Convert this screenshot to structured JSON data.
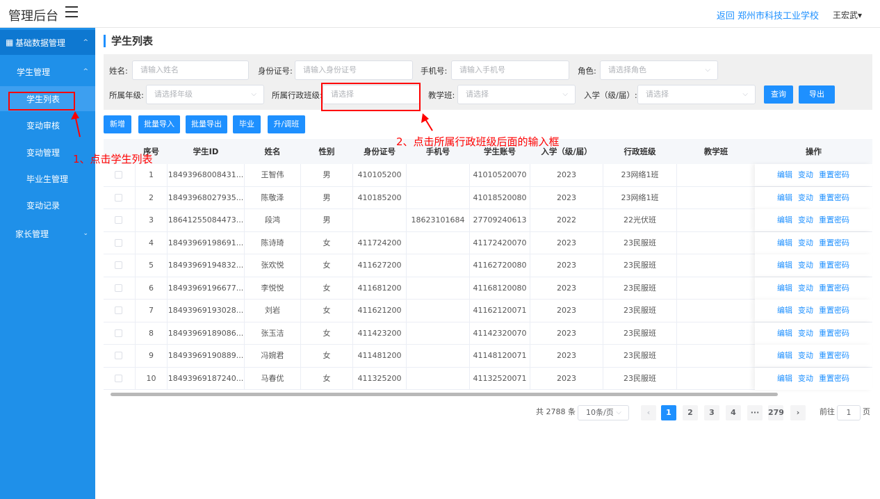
{
  "header": {
    "brand": "管理后台",
    "return_link": "返回 郑州市科技工业学校",
    "user": "王宏武▾"
  },
  "sidebar": {
    "items": [
      {
        "label": "基础数据管理",
        "arrow": "^"
      },
      {
        "label": "学生管理",
        "arrow": "^"
      },
      {
        "label": "学生列表"
      },
      {
        "label": "变动审核"
      },
      {
        "label": "变动管理"
      },
      {
        "label": "毕业生管理"
      },
      {
        "label": "变动记录"
      },
      {
        "label": "家长管理",
        "arrow": "⌄"
      }
    ]
  },
  "page": {
    "title": "学生列表"
  },
  "filters": {
    "name_label": "姓名:",
    "name_placeholder": "请输入姓名",
    "id_label": "身份证号:",
    "id_placeholder": "请输入身份证号",
    "phone_label": "手机号:",
    "phone_placeholder": "请输入手机号",
    "role_label": "角色:",
    "role_placeholder": "请选择角色",
    "grade_label": "所属年级:",
    "grade_placeholder": "请选择年级",
    "class_label": "所属行政班级:",
    "class_placeholder": "请选择",
    "teach_label": "教学班:",
    "teach_placeholder": "请选择",
    "year_label": "入学（级/届）:",
    "year_placeholder": "请选择",
    "query": "查询",
    "export": "导出"
  },
  "toolbar": {
    "add": "新增",
    "bulk_import": "批量导入",
    "bulk_export": "批量导出",
    "graduate": "毕业",
    "upgrade": "升/调班"
  },
  "table": {
    "headers": {
      "idx": "序号",
      "sid": "学生ID",
      "name": "姓名",
      "gender": "性别",
      "idcard": "身份证号",
      "phone": "手机号",
      "account": "学生账号",
      "year": "入学（级/届）",
      "admin_class": "行政班级",
      "teach_class": "教学班",
      "ops": "操作"
    },
    "op_labels": {
      "edit": "编辑",
      "change": "变动",
      "reset": "重置密码"
    },
    "rows": [
      {
        "idx": "1",
        "sid": "18493968008431...",
        "name": "王智伟",
        "gender": "男",
        "idcard": "410105200",
        "phone": "",
        "account": "41010520070",
        "year": "2023",
        "admin_class": "23网络1班",
        "teach_class": ""
      },
      {
        "idx": "2",
        "sid": "18493968027935...",
        "name": "陈敬泽",
        "gender": "男",
        "idcard": "410185200",
        "phone": "",
        "account": "41018520080",
        "year": "2023",
        "admin_class": "23网络1班",
        "teach_class": ""
      },
      {
        "idx": "3",
        "sid": "18641255084473...",
        "name": "段鸿",
        "gender": "男",
        "idcard": "",
        "phone": "18623101684",
        "account": "27709240613",
        "year": "2022",
        "admin_class": "22光伏班",
        "teach_class": ""
      },
      {
        "idx": "4",
        "sid": "18493969198691...",
        "name": "陈诗琦",
        "gender": "女",
        "idcard": "411724200",
        "phone": "",
        "account": "41172420070",
        "year": "2023",
        "admin_class": "23民服班",
        "teach_class": ""
      },
      {
        "idx": "5",
        "sid": "18493969194832...",
        "name": "张欢悦",
        "gender": "女",
        "idcard": "411627200",
        "phone": "",
        "account": "41162720080",
        "year": "2023",
        "admin_class": "23民服班",
        "teach_class": ""
      },
      {
        "idx": "6",
        "sid": "18493969196677...",
        "name": "李悦悦",
        "gender": "女",
        "idcard": "411681200",
        "phone": "",
        "account": "41168120080",
        "year": "2023",
        "admin_class": "23民服班",
        "teach_class": ""
      },
      {
        "idx": "7",
        "sid": "18493969193028...",
        "name": "刘岩",
        "gender": "女",
        "idcard": "411621200",
        "phone": "",
        "account": "41162120071",
        "year": "2023",
        "admin_class": "23民服班",
        "teach_class": ""
      },
      {
        "idx": "8",
        "sid": "18493969189086...",
        "name": "张玉洁",
        "gender": "女",
        "idcard": "411423200",
        "phone": "",
        "account": "41142320070",
        "year": "2023",
        "admin_class": "23民服班",
        "teach_class": ""
      },
      {
        "idx": "9",
        "sid": "18493969190889...",
        "name": "冯婉君",
        "gender": "女",
        "idcard": "411481200",
        "phone": "",
        "account": "41148120071",
        "year": "2023",
        "admin_class": "23民服班",
        "teach_class": ""
      },
      {
        "idx": "10",
        "sid": "18493969187240...",
        "name": "马春优",
        "gender": "女",
        "idcard": "411325200",
        "phone": "",
        "account": "41132520071",
        "year": "2023",
        "admin_class": "23民服班",
        "teach_class": ""
      }
    ]
  },
  "pagination": {
    "total": "共 2788 条",
    "per_page": "10条/页",
    "pages": [
      "1",
      "2",
      "3",
      "4",
      "···",
      "279"
    ],
    "goto_label": "前往",
    "goto_value": "1",
    "page_suffix": "页"
  },
  "annotations": {
    "step1": "1、点击学生列表",
    "step2": "2、点击所属行政班级后面的输入框",
    "color": "#ff0000"
  }
}
